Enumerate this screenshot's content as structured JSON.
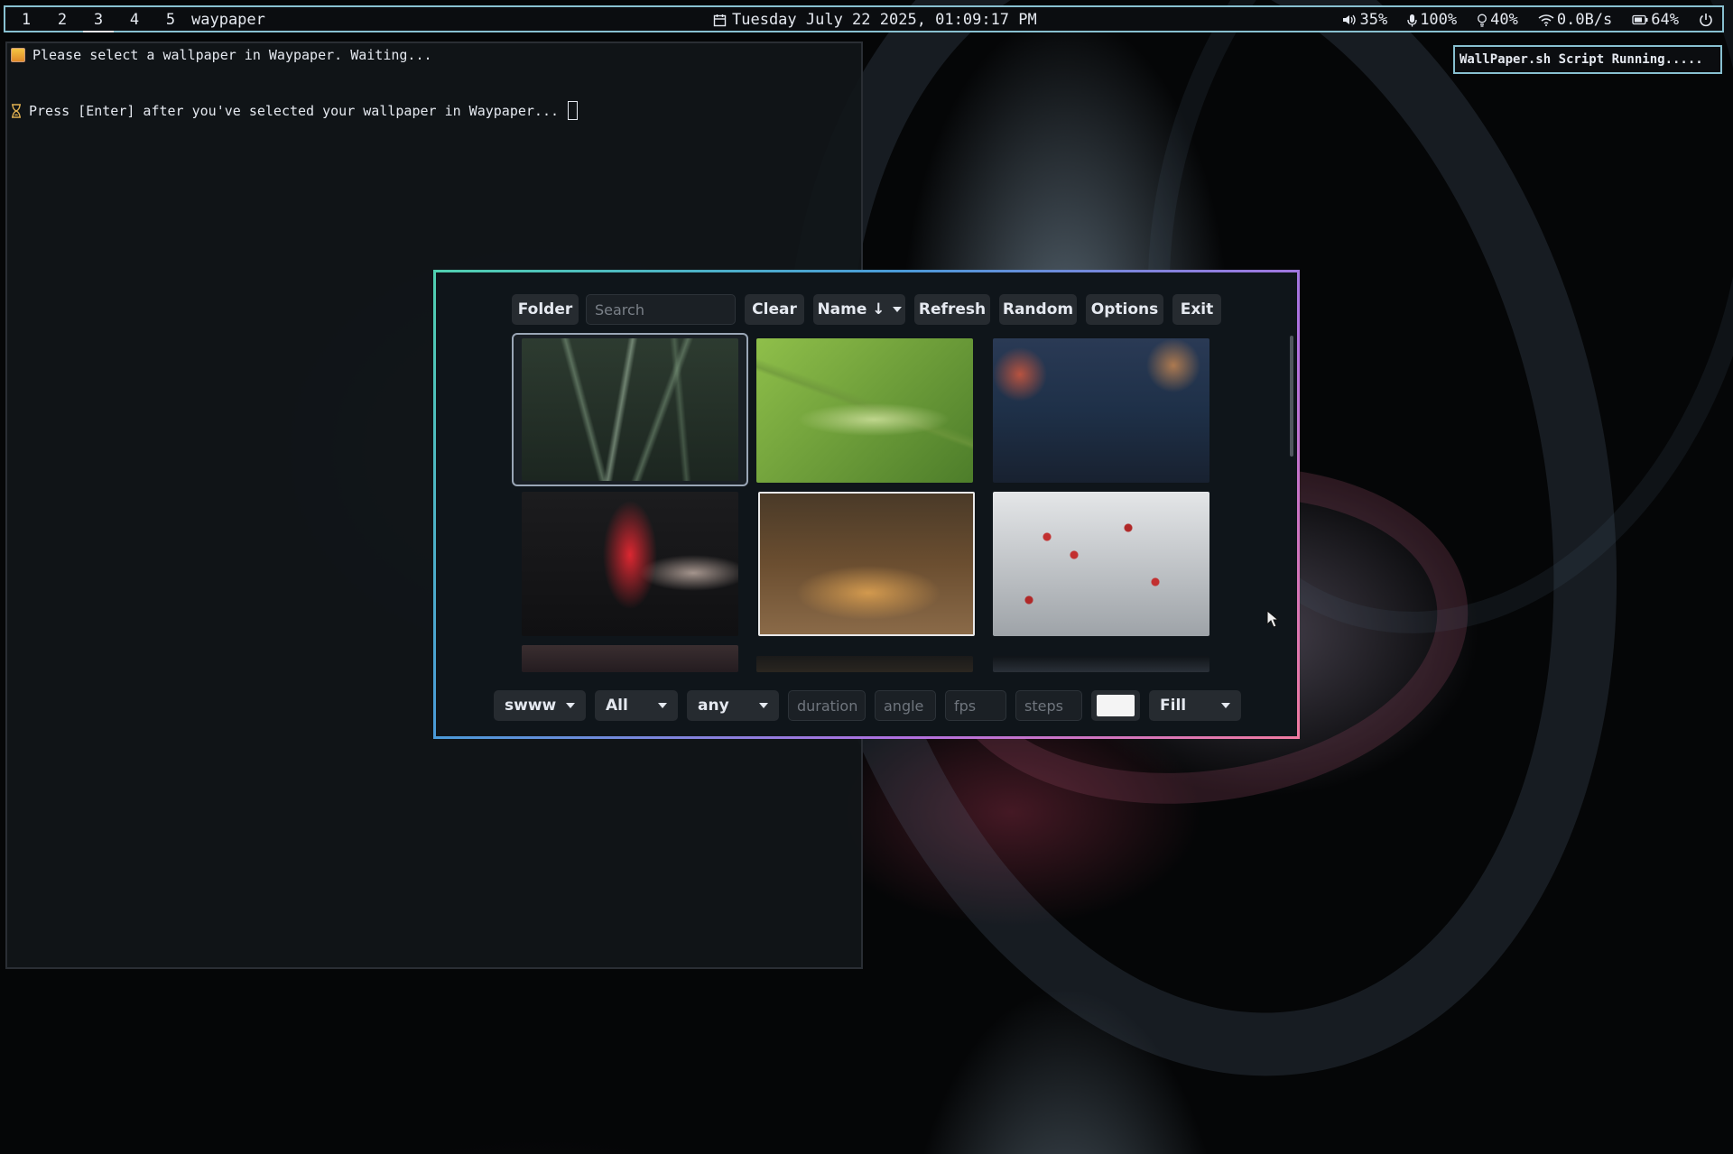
{
  "topbar": {
    "workspaces": [
      "1",
      "2",
      "3",
      "4",
      "5"
    ],
    "active_workspace": "3",
    "window_title": "waypaper",
    "clock": "Tuesday July 22 2025, 01:09:17 PM",
    "volume": "35%",
    "mic": "100%",
    "brightness": "40%",
    "network": "0.0B/s",
    "battery": "64%"
  },
  "notification": {
    "text": "WallPaper.sh Script Running....."
  },
  "terminal": {
    "line1": "Please select a wallpaper in Waypaper. Waiting...",
    "line2": "Press [Enter] after you've selected your wallpaper in Waypaper..."
  },
  "waypaper": {
    "toolbar": {
      "folder": "Folder",
      "search_placeholder": "Search",
      "clear": "Clear",
      "sort": "Name ↓",
      "refresh": "Refresh",
      "random": "Random",
      "options": "Options",
      "exit": "Exit"
    },
    "thumbnails": [
      {
        "name": "grass-blades-dark",
        "selected": true
      },
      {
        "name": "green-wheat-ear",
        "selected": false
      },
      {
        "name": "night-cafe-interior",
        "selected": false
      },
      {
        "name": "red-cocktail-hand",
        "selected": false
      },
      {
        "name": "restaurant-interior",
        "selected": false
      },
      {
        "name": "snowy-red-berries",
        "selected": false
      }
    ],
    "bottom": {
      "backend": "swww",
      "filter": "All",
      "transition": "any",
      "duration_placeholder": "duration",
      "angle_placeholder": "angle",
      "fps_placeholder": "fps",
      "steps_placeholder": "steps",
      "fill": "Fill",
      "bg_color": "#f4f4f4"
    }
  },
  "colors": {
    "bar_border": "#88c0d0",
    "text": "#e5e9f0",
    "button_bg": "#262b30"
  }
}
